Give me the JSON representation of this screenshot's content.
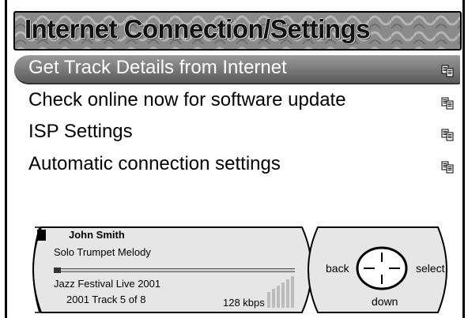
{
  "header": {
    "title": "Internet Connection/Settings"
  },
  "menu": {
    "items": [
      {
        "label": "Get Track Details from Internet",
        "selected": true,
        "icon": "document-icon"
      },
      {
        "label": "Check online now for software update",
        "selected": false,
        "icon": "document-icon"
      },
      {
        "label": "ISP Settings",
        "selected": false,
        "icon": "document-icon"
      },
      {
        "label": "Automatic connection settings",
        "selected": false,
        "icon": "document-icon"
      }
    ]
  },
  "player": {
    "artist": "John Smith",
    "song": "Solo Trumpet Melody",
    "album": "Jazz Festival Live 2001",
    "track_info": "2001  Track 5 of 8",
    "bitrate": "128 kbps",
    "progress_fraction": 0.03,
    "state_icon": "stop-icon"
  },
  "nav": {
    "back": "back",
    "select": "select",
    "down": "down"
  }
}
